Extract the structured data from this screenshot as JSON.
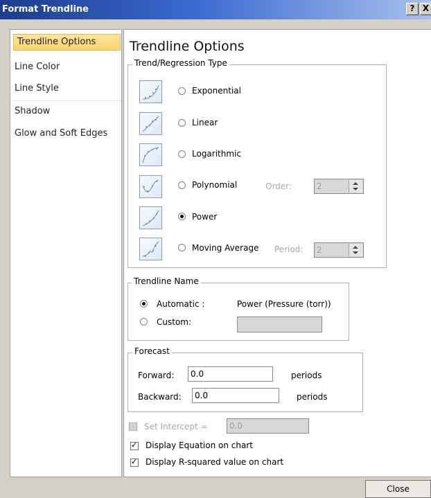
{
  "window": {
    "title": "Format Trendline",
    "help_label": "?",
    "close_label": "X"
  },
  "nav": {
    "items": [
      {
        "label": "Trendline Options"
      },
      {
        "label": "Line Color"
      },
      {
        "label": "Line Style"
      },
      {
        "label": "Shadow"
      },
      {
        "label": "Glow and Soft Edges"
      }
    ],
    "selected": "Trendline Options"
  },
  "page_title": "Trendline Options",
  "trend_type": {
    "legend": "Trend/Regression Type",
    "options": [
      {
        "label": "Exponential",
        "icon": "exponential-icon",
        "selected": false
      },
      {
        "label": "Linear",
        "icon": "linear-icon",
        "selected": false
      },
      {
        "label": "Logarithmic",
        "icon": "logarithmic-icon",
        "selected": false
      },
      {
        "label": "Polynomial",
        "icon": "polynomial-icon",
        "selected": false
      },
      {
        "label": "Power",
        "icon": "power-icon",
        "selected": true
      },
      {
        "label": "Moving Average",
        "icon": "moving-average-icon",
        "selected": false
      }
    ],
    "order_label": "Order:",
    "order_value": "2",
    "period_label": "Period:",
    "period_value": "2"
  },
  "trendline_name": {
    "legend": "Trendline Name",
    "automatic_label": "Automatic :",
    "automatic_value": "Power (Pressure (torr))",
    "custom_label": "Custom:",
    "custom_value": "",
    "selected": "automatic"
  },
  "forecast": {
    "legend": "Forecast",
    "forward_label": "Forward:",
    "forward_value": "0.0",
    "backward_label": "Backward:",
    "backward_value": "0.0",
    "unit_label": "periods"
  },
  "options": {
    "set_intercept_label": "Set Intercept =",
    "set_intercept_value": "0.0",
    "set_intercept_checked": false,
    "display_equation_label": "Display Equation on chart",
    "display_equation_checked": true,
    "display_rsquared_label": "Display R-squared value on chart",
    "display_rsquared_checked": true
  },
  "footer": {
    "close_label": "Close"
  },
  "colors": {
    "title_bar": "#1c3c8e",
    "nav_selected": "#fbd36b"
  }
}
